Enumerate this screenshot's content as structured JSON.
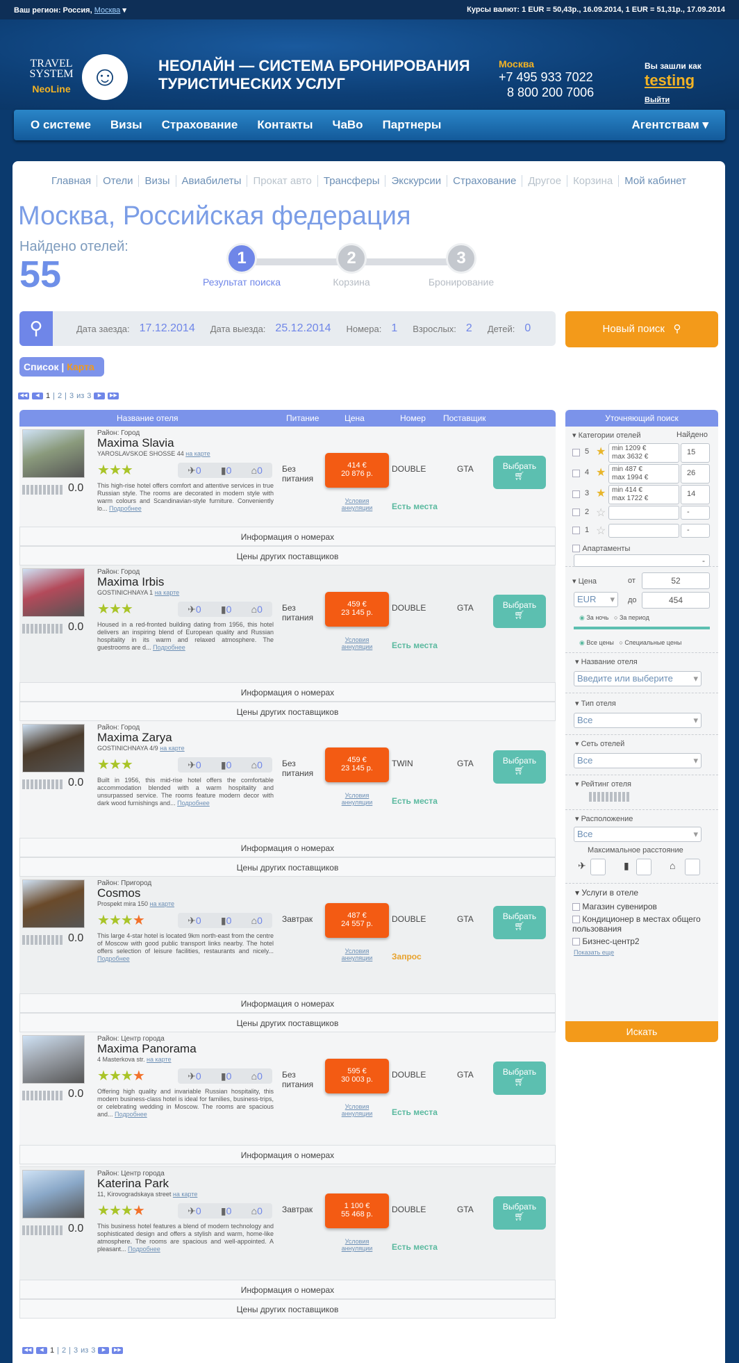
{
  "topbar": {
    "region_label": "Ваш регион: Россия,",
    "region_city": "Москва",
    "rates": "Курсы валют: 1 EUR = 50,43р., 16.09.2014, 1 EUR = 51,31р., 17.09.2014"
  },
  "header": {
    "logo_top": "TRAVEL SYSTEM",
    "logo_bottom": "NeoLine",
    "title": "НЕОЛАЙН — СИСТЕМА БРОНИРОВАНИЯ ТУРИСТИЧЕСКИХ УСЛУГ",
    "city": "Москва",
    "phone1": "+7 495 933 7022",
    "phone2": "8 800 200 7006",
    "login_label": "Вы зашли как",
    "username": "testing",
    "logout": "Выйти"
  },
  "nav": {
    "items": [
      "О системе",
      "Визы",
      "Страхование",
      "Контакты",
      "ЧаВо",
      "Партнеры"
    ],
    "right": "Агентствам ▾"
  },
  "breadcrumbs": [
    "Главная",
    "Отели",
    "Визы",
    "Авиабилеты",
    "Прокат авто",
    "Трансферы",
    "Экскурсии",
    "Страхование",
    "Другое",
    "Корзина",
    "Мой кабинет"
  ],
  "city_title": "Москва, Российская федерация",
  "found": {
    "label": "Найдено отелей:",
    "count": "55"
  },
  "steps": [
    {
      "n": "1",
      "label": "Результат поиска"
    },
    {
      "n": "2",
      "label": "Корзина"
    },
    {
      "n": "3",
      "label": "Бронирование"
    }
  ],
  "search": {
    "checkin_label": "Дата заезда:",
    "checkin": "17.12.2014",
    "checkout_label": "Дата выезда:",
    "checkout": "25.12.2014",
    "rooms_label": "Номера:",
    "rooms": "1",
    "adults_label": "Взрослых:",
    "adults": "2",
    "children_label": "Детей:",
    "children": "0",
    "new_search": "Новый поиск"
  },
  "view": {
    "list": "Список",
    "map": "Карта"
  },
  "pager": {
    "pages": [
      "1",
      "2",
      "3"
    ],
    "of": "из",
    "total": "3"
  },
  "columns": {
    "name": "Название отеля",
    "food": "Питание",
    "price": "Цена",
    "room": "Номер",
    "supplier": "Поставщик"
  },
  "sub": {
    "rooms_info": "Информация о номерах",
    "other_prices": "Цены других поставщиков"
  },
  "hotels": [
    {
      "district": "Район: Город",
      "name": "Maxima Slavia",
      "address": "YAROSLAVSKOE SHOSSE 44",
      "map": "на карте",
      "stars": 3,
      "rating": "0.0",
      "t1": "0",
      "t2": "0",
      "t3": "0",
      "desc": "This high-rise hotel offers comfort and attentive services in true Russian style. The rooms are decorated in modern style with warm colours and Scandinavian-style furniture. Conveniently lo...",
      "more": "Подробнее",
      "food": "Без питания",
      "price_eur": "414 €",
      "price_rub": "20 876 р.",
      "cond": "Условия аннуляции",
      "room": "DOUBLE",
      "supplier": "GTA",
      "avail": "Есть места",
      "select": "Выбрать",
      "thumb": "#8a9a7c"
    },
    {
      "district": "Район: Город",
      "name": "Maxima Irbis",
      "address": "GOSTINICHNAYA 1",
      "map": "на карте",
      "stars": 3,
      "rating": "0.0",
      "t1": "0",
      "t2": "0",
      "t3": "0",
      "desc": "Housed in a red-fronted building dating from 1956, this hotel delivers an inspiring blend of European quality and Russian hospitality in its warm and relaxed atmosphere. The guestrooms are d...",
      "more": "Подробнее",
      "food": "Без питания",
      "price_eur": "459 €",
      "price_rub": "23 145 р.",
      "cond": "Условия аннуляции",
      "room": "DOUBLE",
      "supplier": "GTA",
      "avail": "Есть места",
      "select": "Выбрать",
      "thumb": "#b34a5a"
    },
    {
      "district": "Район: Город",
      "name": "Maxima Zarya",
      "address": "GOSTINICHNAYA 4/9",
      "map": "на карте",
      "stars": 3,
      "rating": "0.0",
      "t1": "0",
      "t2": "0",
      "t3": "0",
      "desc": "Built in 1956, this mid-rise hotel offers the comfortable accommodation blended with a warm hospitality and unsurpassed service. The rooms feature modern decor with dark wood furnishings and...",
      "more": "Подробнее",
      "food": "Без питания",
      "price_eur": "459 €",
      "price_rub": "23 145 р.",
      "cond": "Условия аннуляции",
      "room": "TWIN",
      "supplier": "GTA",
      "avail": "Есть места",
      "select": "Выбрать",
      "thumb": "#4a3a2a"
    },
    {
      "district": "Район: Пригород",
      "name": "Cosmos",
      "address": "Prospekt mira 150",
      "map": "на карте",
      "stars": 4,
      "rating": "0.0",
      "t1": "0",
      "t2": "0",
      "t3": "0",
      "desc": "This large 4-star hotel is located 9km north-east from the centre of Moscow with good public transport links nearby. The hotel offers selection of leisure facilities, restaurants and nicely...",
      "more": "Подробнее",
      "food": "Завтрак",
      "price_eur": "487 €",
      "price_rub": "24 557 р.",
      "cond": "Условия аннуляции",
      "room": "DOUBLE",
      "supplier": "GTA",
      "avail": "Запрос",
      "select": "Выбрать",
      "thumb": "#6a4a2a"
    },
    {
      "district": "Район: Центр города",
      "name": "Maxima Panorama",
      "address": "4 Masterkova str.",
      "map": "на карте",
      "stars": 4,
      "rating": "0.0",
      "t1": "0",
      "t2": "0",
      "t3": "0",
      "desc": "Offering high quality and invariable Russian hospitality, this modern business-class hotel is ideal for families, business-trips, or celebrating wedding in Moscow. The rooms are spacious and...",
      "more": "Подробнее",
      "food": "Без питания",
      "price_eur": "595 €",
      "price_rub": "30 003 р.",
      "cond": "Условия аннуляции",
      "room": "DOUBLE",
      "supplier": "GTA",
      "avail": "Есть места",
      "select": "Выбрать",
      "thumb": "#9aa0a8"
    },
    {
      "district": "Район: Центр города",
      "name": "Katerina Park",
      "address": "11, Kirovogradskaya street",
      "map": "на карте",
      "stars": 4,
      "rating": "0.0",
      "t1": "0",
      "t2": "0",
      "t3": "0",
      "desc": "This business hotel features a blend of modern technology and sophisticated design and offers a stylish and warm, home-like atmosphere. The rooms are spacious and well-appointed. A pleasant...",
      "more": "Подробнее",
      "food": "Завтрак",
      "price_eur": "1 100 €",
      "price_rub": "55 468 р.",
      "cond": "Условия аннуляции",
      "room": "DOUBLE",
      "supplier": "GTA",
      "avail": "Есть места",
      "select": "Выбрать",
      "thumb": "#8aa8c8"
    }
  ],
  "filter": {
    "title": "Уточняющий поиск",
    "cat_label": "Категории отелей",
    "found_label": "Найдено",
    "cats": [
      {
        "n": "5",
        "min": "min 1209 €",
        "max": "max 3632 €",
        "count": "15"
      },
      {
        "n": "4",
        "min": "min 487 €",
        "max": "max 1994 €",
        "count": "26"
      },
      {
        "n": "3",
        "min": "min 414 €",
        "max": "max 1722 €",
        "count": "14"
      },
      {
        "n": "2",
        "min": "",
        "max": "",
        "count": "-"
      },
      {
        "n": "1",
        "min": "",
        "max": "",
        "count": "-"
      }
    ],
    "apart": "Апартаменты",
    "apart_count": "-",
    "price_label": "Цена",
    "from": "от",
    "from_val": "52",
    "to": "до",
    "to_val": "454",
    "currency": "EUR",
    "per_night": "За ночь",
    "per_period": "За период",
    "all_prices": "Все цены",
    "special": "Специальные цены",
    "hotel_name": "Название отеля",
    "hotel_name_ph": "Введите или выберите",
    "hotel_type": "Тип отеля",
    "chain": "Сеть отелей",
    "all": "Все",
    "rating": "Рейтинг отеля",
    "location": "Расположение",
    "max_dist": "Максимальное расстояние",
    "services": "Услуги в отеле",
    "svc": [
      "Магазин сувениров",
      "Кондиционер в местах общего пользования",
      "Бизнес-центр2"
    ],
    "show_more": "Показать еще",
    "go": "Искать"
  }
}
